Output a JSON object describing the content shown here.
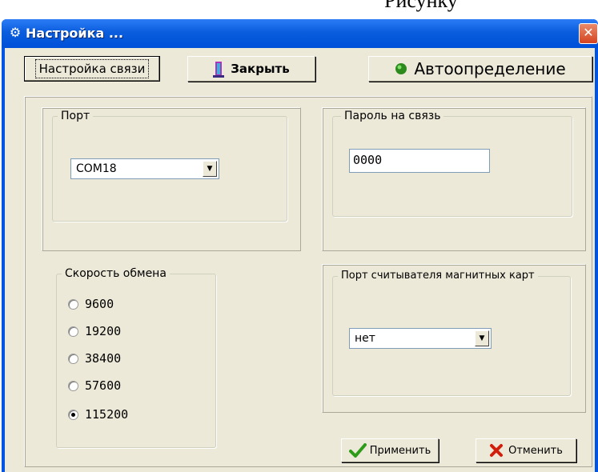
{
  "page_header": "Рисунку",
  "window": {
    "title": "Настройка ...",
    "close_label": "✕"
  },
  "toolbar": {
    "tab_connection": "Настройка связи",
    "close_button": "Закрыть",
    "auto_button": "Автоопределение"
  },
  "port": {
    "legend": "Порт",
    "value": "COM18"
  },
  "password": {
    "legend": "Пароль на связь",
    "value": "0000"
  },
  "speed": {
    "legend": "Скорость обмена",
    "options": [
      "9600",
      "19200",
      "38400",
      "57600",
      "115200"
    ],
    "selected": "115200"
  },
  "card_reader": {
    "legend": "Порт считывателя магнитных карт",
    "value": "нет"
  },
  "actions": {
    "apply": "Применить",
    "cancel": "Отменить"
  },
  "colors": {
    "titlebar": "#0a5ddd",
    "client": "#ece9d8",
    "apply_icon": "#2e9b18",
    "cancel_icon": "#d11f0b",
    "auto_icon": "#2d8a1d"
  }
}
